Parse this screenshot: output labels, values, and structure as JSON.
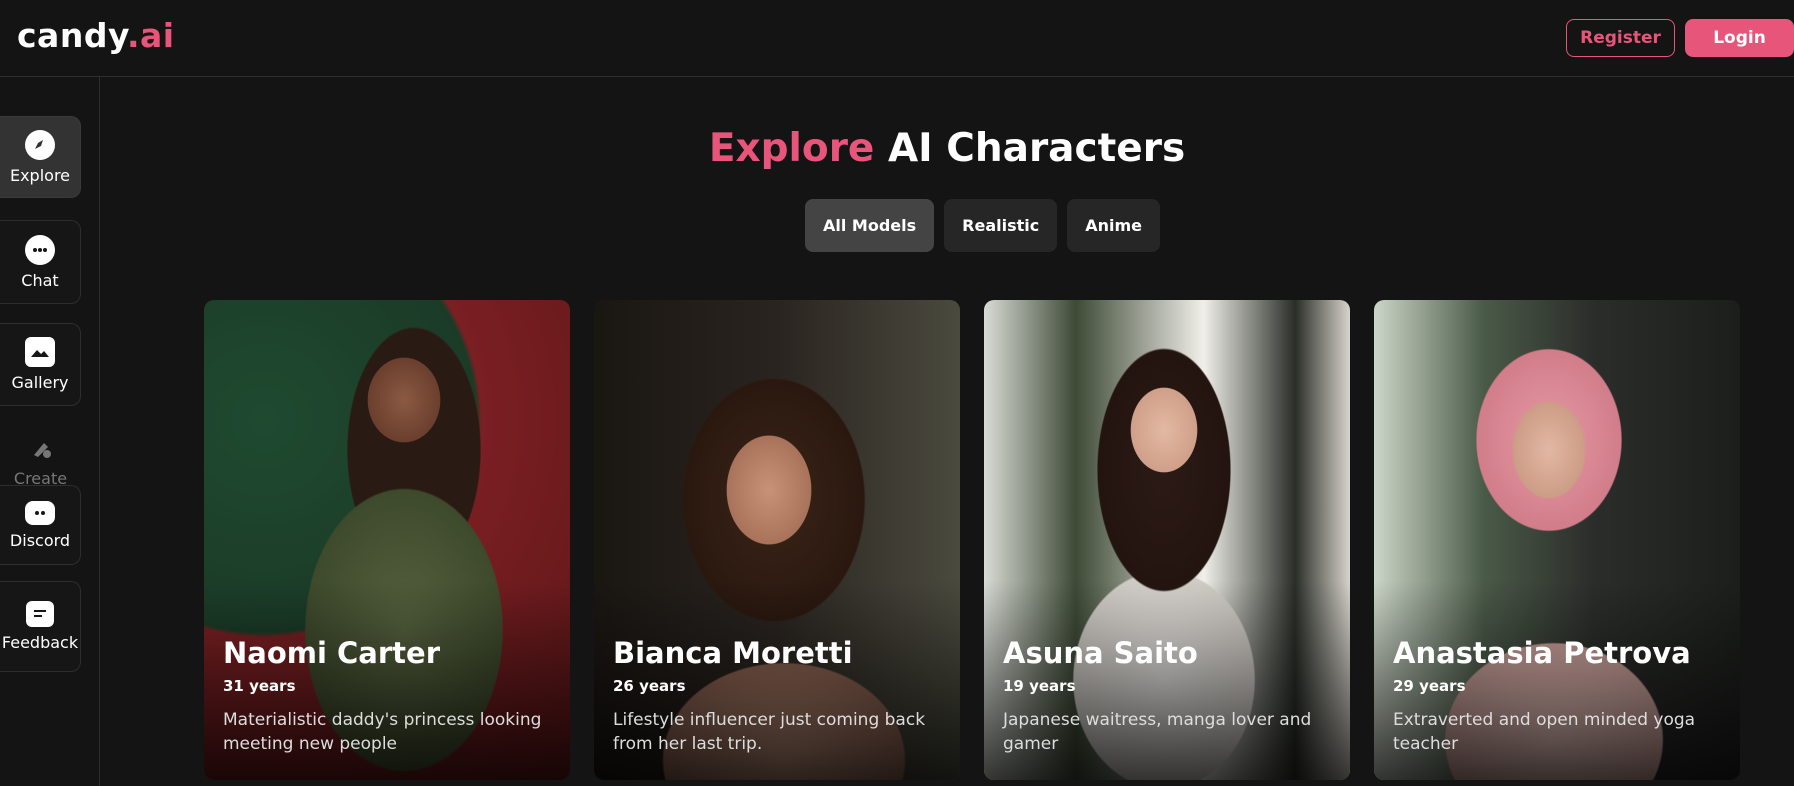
{
  "header": {
    "logo_main": "candy",
    "logo_accent": ".ai",
    "register_label": "Register",
    "login_label": "Login"
  },
  "sidebar": {
    "items": [
      {
        "label": "Explore",
        "icon": "compass-icon"
      },
      {
        "label": "Chat",
        "icon": "chat-bubble-icon"
      },
      {
        "label": "Gallery",
        "icon": "gallery-icon"
      },
      {
        "label": "Create",
        "icon": "create-icon"
      },
      {
        "label": "Discord",
        "icon": "discord-icon"
      },
      {
        "label": "Feedback",
        "icon": "feedback-icon"
      }
    ]
  },
  "main": {
    "title_accent": "Explore",
    "title_rest": "AI Characters",
    "filters": [
      "All Models",
      "Realistic",
      "Anime"
    ],
    "active_filter": "All Models",
    "characters": [
      {
        "name": "Naomi Carter",
        "age": "31 years",
        "desc": "Materialistic daddy's princess looking meeting new people"
      },
      {
        "name": "Bianca Moretti",
        "age": "26 years",
        "desc": "Lifestyle influencer just coming back from her last trip."
      },
      {
        "name": "Asuna Saito",
        "age": "19 years",
        "desc": "Japanese waitress, manga lover and gamer"
      },
      {
        "name": "Anastasia Petrova",
        "age": "29 years",
        "desc": "Extraverted and open minded yoga teacher"
      }
    ]
  },
  "colors": {
    "accent": "#e8557a",
    "background": "#141414"
  }
}
